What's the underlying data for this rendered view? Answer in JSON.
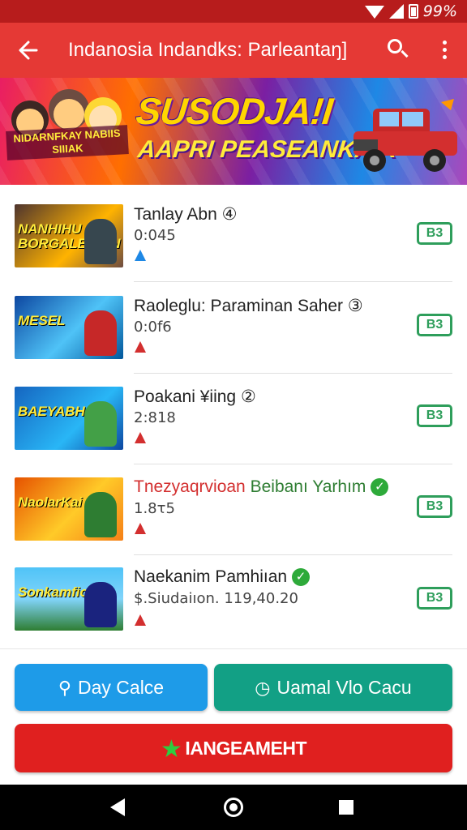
{
  "status_bar": {
    "battery": "99%"
  },
  "app_bar": {
    "title": "Indanosia Indandks: Parleantaŋ]"
  },
  "banner": {
    "headline": "SUSODJA!I",
    "subline": "AAPRI PEASEANKAIK",
    "small_logo": "NIDARNFKAY NABIIS SIIIAK"
  },
  "list": [
    {
      "title": "Tanlay Abn",
      "num_badge": "④",
      "subtitle": "0:045",
      "tag_color": "#1e88e5",
      "badge": "B3",
      "thumb_text": "NANHIHU BORGALEARIN"
    },
    {
      "title": "Raoleglu: Paraminan Saher",
      "num_badge": "③",
      "subtitle": "0:0f6",
      "tag_color": "#d32f2f",
      "badge": "B3",
      "thumb_text": "MESEL"
    },
    {
      "title": "Poakani ¥iing",
      "num_badge": "②",
      "subtitle": "2:818",
      "tag_color": "#d32f2f",
      "badge": "B3",
      "thumb_text": "BAEYABHOIN"
    },
    {
      "title_red": "Tnezyaqrvioan",
      "title_green": "Beibanı Yarhım",
      "subtitle": "1.8τ5",
      "tag_color": "#d32f2f",
      "badge": "B3",
      "thumb_text": "NaolarKai"
    },
    {
      "title": "Naekanim Pamhiıan",
      "subtitle": "$.Siudaiıon. 119,40.20",
      "tag_color": "#d32f2f",
      "badge": "B3",
      "thumb_text": "Sonkamfion"
    }
  ],
  "buttons": {
    "day": "Day Calce",
    "uamal": "Uamal Vlo Cacu",
    "main": "IANGEAMEHT"
  },
  "colors": {
    "app_bar": "#e53935",
    "status_bar": "#b71c1c",
    "button_blue": "#1e9be8",
    "button_teal": "#12a085",
    "button_red": "#e0201f",
    "badge_green": "#2e9e5b"
  }
}
